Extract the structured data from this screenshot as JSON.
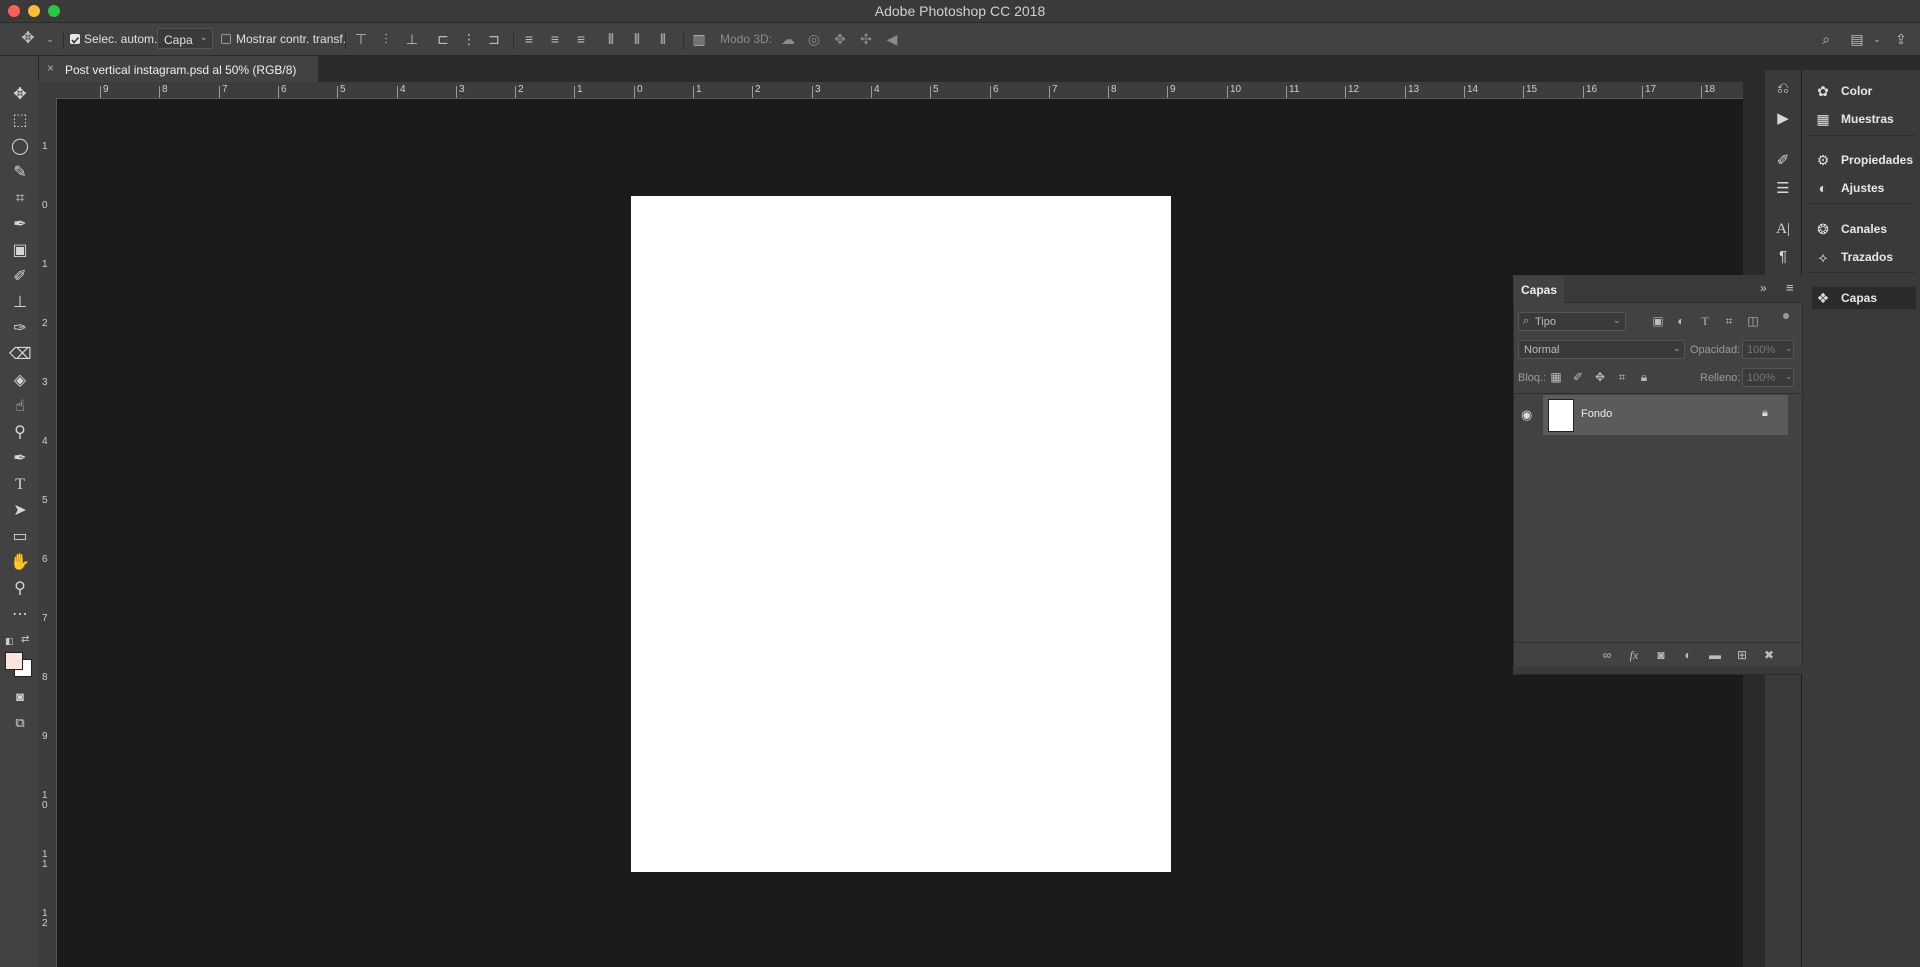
{
  "window": {
    "title": "Adobe Photoshop CC 2018",
    "traffic_lights": {
      "close": "#fe5f57",
      "minimize": "#febc2e",
      "zoom": "#28c840"
    }
  },
  "options_bar": {
    "move_tool_icon": "move-arrows-icon",
    "auto_select_checked": true,
    "auto_select_label": "Selec. autom.:",
    "auto_select_target": "Capa",
    "show_transform_checked": false,
    "show_transform_label": "Mostrar contr. transf.",
    "mode3d_label": "Modo 3D:"
  },
  "document_tab": {
    "title": "Post vertical instagram.psd al 50% (RGB/8)",
    "close_glyph": "×"
  },
  "ruler": {
    "horizontal_labels": [
      "9",
      "8",
      "7",
      "6",
      "5",
      "4",
      "3",
      "2",
      "1",
      "0",
      "1",
      "2",
      "3",
      "4",
      "5",
      "6",
      "7",
      "8",
      "9",
      "10",
      "11",
      "12",
      "13",
      "14",
      "15",
      "16",
      "17",
      "18"
    ],
    "vertical_labels": [
      "1",
      "0",
      "1",
      "2",
      "3",
      "4",
      "5",
      "6",
      "7",
      "8",
      "9",
      "10",
      "11",
      "12"
    ]
  },
  "tools": [
    "move-tool",
    "marquee-tool",
    "lasso-tool",
    "quick-select-tool",
    "crop-tool",
    "eyedropper-tool",
    "frame-tool",
    "brush-tool",
    "stamp-tool",
    "history-brush-tool",
    "eraser-tool",
    "paint-bucket-tool",
    "smudge-tool",
    "dodge-tool",
    "pen-tool",
    "type-tool",
    "path-select-tool",
    "rectangle-tool",
    "hand-tool",
    "zoom-tool",
    "more-tools"
  ],
  "colors": {
    "foreground": "#fde4dc",
    "background": "#ffffff",
    "accent_checkbox": "#e6e6e6"
  },
  "right_panel": {
    "items": [
      {
        "icon": "color-wheel-icon",
        "label": "Color"
      },
      {
        "icon": "swatches-grid-icon",
        "label": "Muestras"
      },
      {
        "icon": "properties-icon",
        "label": "Propiedades"
      },
      {
        "icon": "adjustments-icon",
        "label": "Ajustes"
      },
      {
        "icon": "channels-icon",
        "label": "Canales"
      },
      {
        "icon": "paths-icon",
        "label": "Trazados"
      },
      {
        "icon": "layers-icon",
        "label": "Capas"
      }
    ]
  },
  "layers_panel": {
    "tab_label": "Capas",
    "filter_label": "Tipo",
    "blend_mode": "Normal",
    "opacity_label": "Opacidad:",
    "opacity_value": "100%",
    "lock_label": "Bloq.:",
    "fill_label": "Relleno:",
    "fill_value": "100%",
    "layers": [
      {
        "name": "Fondo",
        "visible": true,
        "locked": true
      }
    ]
  }
}
